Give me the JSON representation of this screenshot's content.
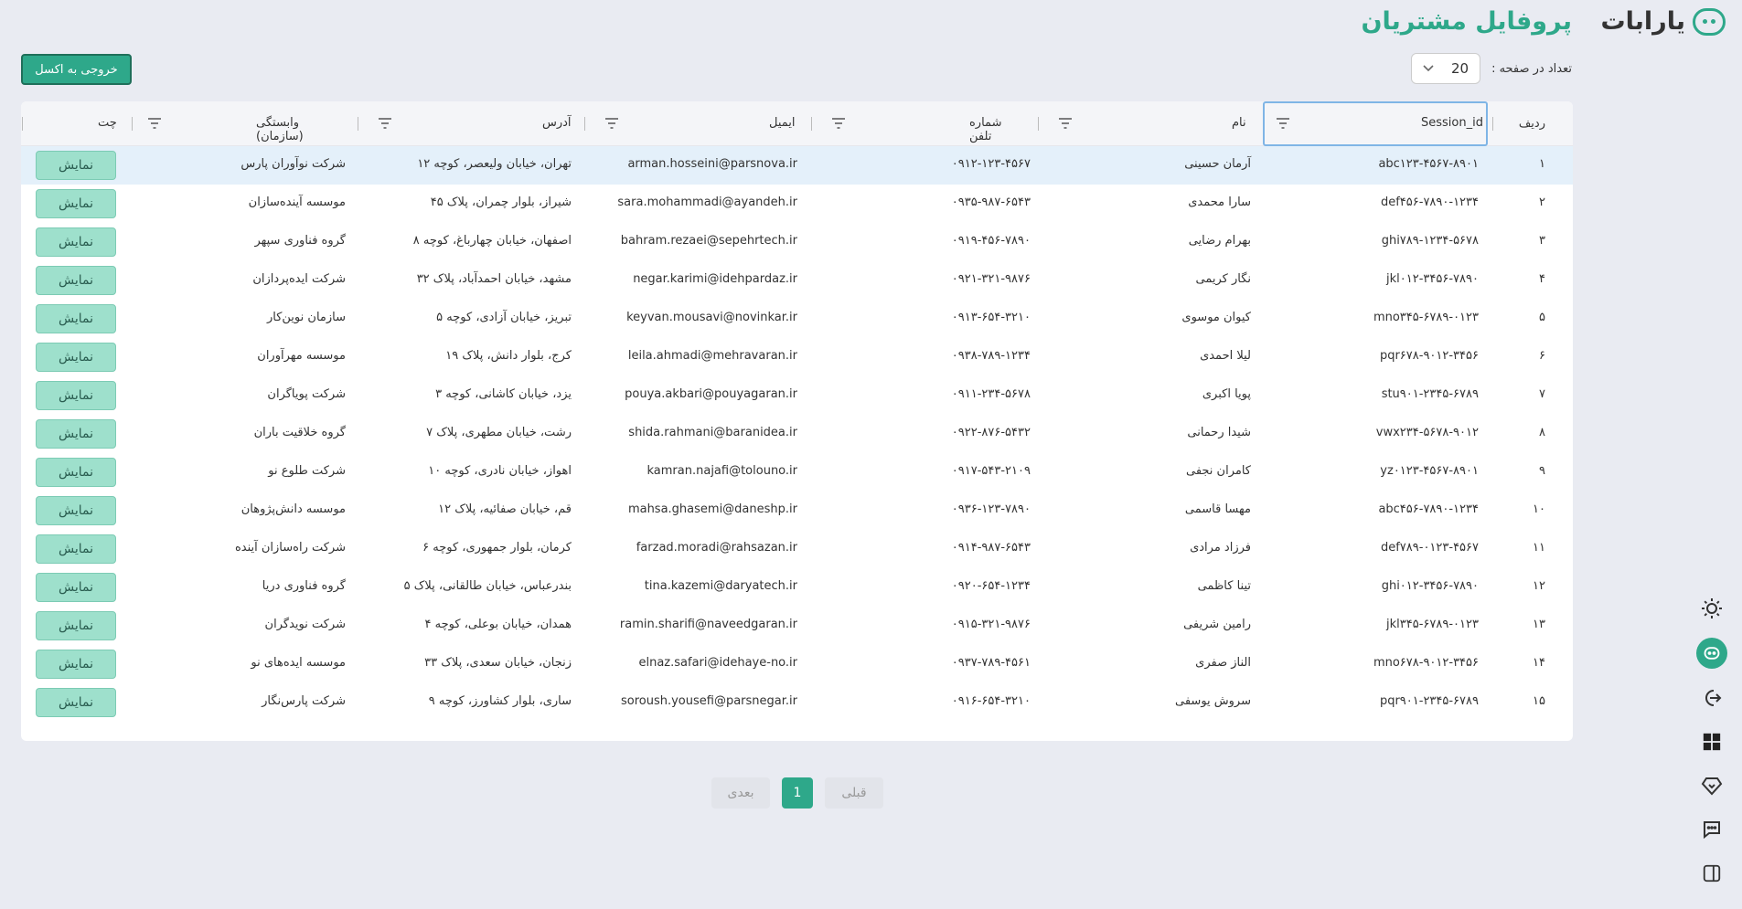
{
  "app": {
    "logo_text": "یارابات"
  },
  "header": {
    "title": "پروفایل مشتریان",
    "per_page_label": "تعداد در صفحه :",
    "per_page_value": "20",
    "export_label": "خروجی به اکسل"
  },
  "table": {
    "columns": {
      "index": "ردیف",
      "session_id": "Session_id",
      "name": "نام",
      "phone": "شماره تلفن",
      "email": "ایمیل",
      "address": "آدرس",
      "org": "وابستگی (سازمان)",
      "chat": "چت"
    },
    "show_label": "نمایش",
    "rows": [
      {
        "index": "۱",
        "session_id": "abc۱۲۳-۴۵۶۷-۸۹۰۱",
        "name": "آرمان حسینی",
        "phone": "۰۹۱۲-۱۲۳-۴۵۶۷",
        "email": "arman.hosseini@parsnova.ir",
        "address": "تهران، خیابان ولیعصر، کوچه ۱۲",
        "org": "شرکت نوآوران پارس"
      },
      {
        "index": "۲",
        "session_id": "def۴۵۶-۷۸۹۰-۱۲۳۴",
        "name": "سارا محمدی",
        "phone": "۰۹۳۵-۹۸۷-۶۵۴۳",
        "email": "sara.mohammadi@ayandeh.ir",
        "address": "شیراز، بلوار چمران، پلاک ۴۵",
        "org": "موسسه آینده‌سازان"
      },
      {
        "index": "۳",
        "session_id": "ghi۷۸۹-۱۲۳۴-۵۶۷۸",
        "name": "بهرام رضایی",
        "phone": "۰۹۱۹-۴۵۶-۷۸۹۰",
        "email": "bahram.rezaei@sepehrtech.ir",
        "address": "اصفهان، خیابان چهارباغ، کوچه ۸",
        "org": "گروه فناوری سپهر"
      },
      {
        "index": "۴",
        "session_id": "jkl۰۱۲-۳۴۵۶-۷۸۹۰",
        "name": "نگار کریمی",
        "phone": "۰۹۲۱-۳۲۱-۹۸۷۶",
        "email": "negar.karimi@idehpardaz.ir",
        "address": "مشهد، خیابان احمدآباد، پلاک ۳۲",
        "org": "شرکت ایده‌پردازان"
      },
      {
        "index": "۵",
        "session_id": "mno۳۴۵-۶۷۸۹-۰۱۲۳",
        "name": "کیوان موسوی",
        "phone": "۰۹۱۳-۶۵۴-۳۲۱۰",
        "email": "keyvan.mousavi@novinkar.ir",
        "address": "تبریز، خیابان آزادی، کوچه ۵",
        "org": "سازمان نوین‌کار"
      },
      {
        "index": "۶",
        "session_id": "pqr۶۷۸-۹۰۱۲-۳۴۵۶",
        "name": "لیلا احمدی",
        "phone": "۰۹۳۸-۷۸۹-۱۲۳۴",
        "email": "leila.ahmadi@mehravaran.ir",
        "address": "کرج، بلوار دانش، پلاک ۱۹",
        "org": "موسسه مهرآوران"
      },
      {
        "index": "۷",
        "session_id": "stu۹۰۱-۲۳۴۵-۶۷۸۹",
        "name": "پویا اکبری",
        "phone": "۰۹۱۱-۲۳۴-۵۶۷۸",
        "email": "pouya.akbari@pouyagaran.ir",
        "address": "یزد، خیابان کاشانی، کوچه ۳",
        "org": "شرکت پویاگران"
      },
      {
        "index": "۸",
        "session_id": "vwx۲۳۴-۵۶۷۸-۹۰۱۲",
        "name": "شیدا رحمانی",
        "phone": "۰۹۲۲-۸۷۶-۵۴۳۲",
        "email": "shida.rahmani@baranidea.ir",
        "address": "رشت، خیابان مطهری، پلاک ۷",
        "org": "گروه خلاقیت باران"
      },
      {
        "index": "۹",
        "session_id": "yz۰۱۲۳-۴۵۶۷-۸۹۰۱",
        "name": "کامران نجفی",
        "phone": "۰۹۱۷-۵۴۳-۲۱۰۹",
        "email": "kamran.najafi@tolouno.ir",
        "address": "اهواز، خیابان نادری، کوچه ۱۰",
        "org": "شرکت طلوع نو"
      },
      {
        "index": "۱۰",
        "session_id": "abc۴۵۶-۷۸۹۰-۱۲۳۴",
        "name": "مهسا قاسمی",
        "phone": "۰۹۳۶-۱۲۳-۷۸۹۰",
        "email": "mahsa.ghasemi@daneshp.ir",
        "address": "قم، خیابان صفائیه، پلاک ۱۲",
        "org": "موسسه دانش‌پژوهان"
      },
      {
        "index": "۱۱",
        "session_id": "def۷۸۹-۰۱۲۳-۴۵۶۷",
        "name": "فرزاد مرادی",
        "phone": "۰۹۱۴-۹۸۷-۶۵۴۳",
        "email": "farzad.moradi@rahsazan.ir",
        "address": "کرمان، بلوار جمهوری، کوچه ۶",
        "org": "شرکت راه‌سازان آینده"
      },
      {
        "index": "۱۲",
        "session_id": "ghi۰۱۲-۳۴۵۶-۷۸۹۰",
        "name": "تینا کاظمی",
        "phone": "۰۹۲۰-۶۵۴-۱۲۳۴",
        "email": "tina.kazemi@daryatech.ir",
        "address": "بندرعباس، خیابان طالقانی، پلاک ۵",
        "org": "گروه فناوری دریا"
      },
      {
        "index": "۱۳",
        "session_id": "jkl۳۴۵-۶۷۸۹-۰۱۲۳",
        "name": "رامین شریفی",
        "phone": "۰۹۱۵-۳۲۱-۹۸۷۶",
        "email": "ramin.sharifi@naveedgaran.ir",
        "address": "همدان، خیابان بوعلی، کوچه ۴",
        "org": "شرکت نویدگران"
      },
      {
        "index": "۱۴",
        "session_id": "mno۶۷۸-۹۰۱۲-۳۴۵۶",
        "name": "الناز صفری",
        "phone": "۰۹۳۷-۷۸۹-۴۵۶۱",
        "email": "elnaz.safari@idehaye-no.ir",
        "address": "زنجان، خیابان سعدی، پلاک ۳۳",
        "org": "موسسه ایده‌های نو"
      },
      {
        "index": "۱۵",
        "session_id": "pqr۹۰۱-۲۳۴۵-۶۷۸۹",
        "name": "سروش یوسفی",
        "phone": "۰۹۱۶-۶۵۴-۳۲۱۰",
        "email": "soroush.yousefi@parsnegar.ir",
        "address": "ساری، بلوار کشاورز، کوچه ۹",
        "org": "شرکت پارس‌نگار"
      }
    ]
  },
  "pagination": {
    "prev": "قبلی",
    "current": "1",
    "next": "بعدی"
  },
  "colors": {
    "accent": "#2ea88a",
    "show_button": "#9ee0cc",
    "background": "#e9ebf2"
  }
}
